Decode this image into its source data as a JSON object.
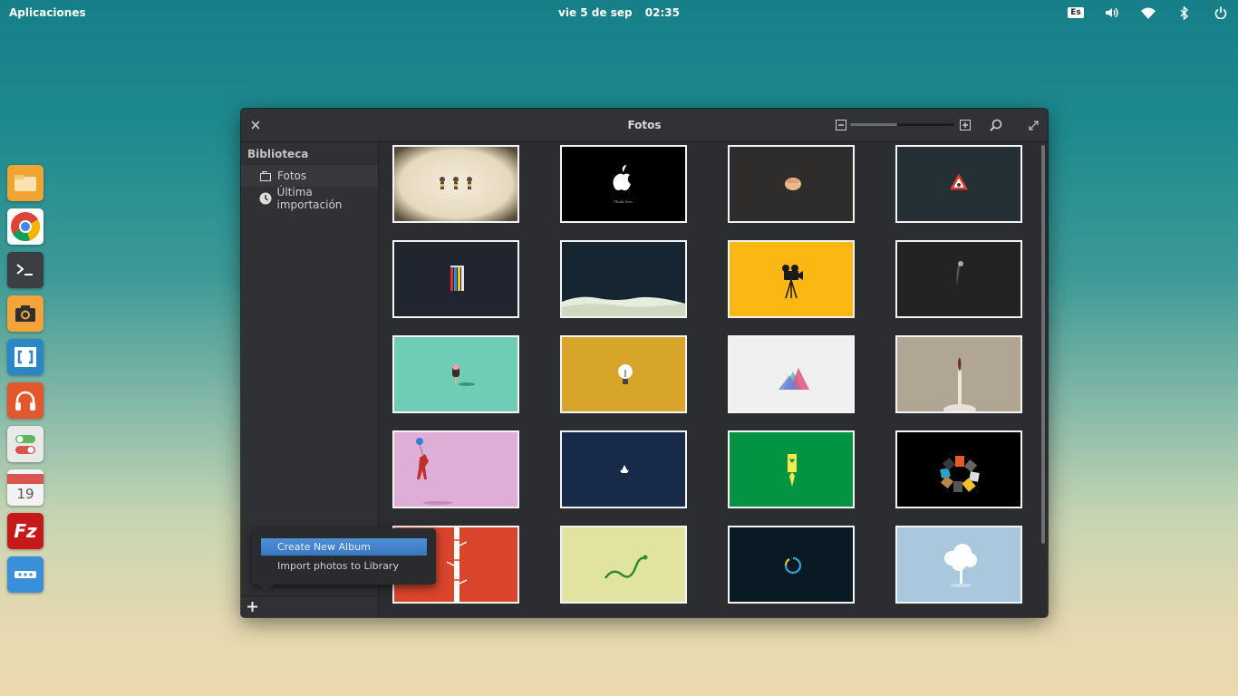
{
  "topbar": {
    "apps_label": "Aplicaciones",
    "date": "vie  5 de sep",
    "time": "02:35",
    "keyboard_layout": "Es",
    "icons": [
      "volume-icon",
      "wifi-icon",
      "bluetooth-icon",
      "power-icon"
    ]
  },
  "dock": {
    "apps": [
      {
        "name": "files",
        "color": "#f0a433"
      },
      {
        "name": "chrome",
        "color": "#ffffff"
      },
      {
        "name": "terminal",
        "color": "#3b3e42"
      },
      {
        "name": "camera",
        "color": "#f2a43a"
      },
      {
        "name": "brackets",
        "color": "#2b86c5"
      },
      {
        "name": "music",
        "color": "#e2572b"
      },
      {
        "name": "settings-toggles",
        "color": "#e9e9e9"
      },
      {
        "name": "calendar",
        "color": "#f3f3f3",
        "day": "19"
      },
      {
        "name": "filezilla",
        "color": "#c51a1a",
        "letter": "Fz"
      },
      {
        "name": "more-apps",
        "color": "#3a8fd9"
      }
    ]
  },
  "window": {
    "title": "Fotos",
    "zoom_level": 0.45
  },
  "sidebar": {
    "heading": "Biblioteca",
    "items": [
      {
        "label": "Fotos",
        "icon": "photos-icon",
        "active": true
      },
      {
        "label": "Última importación",
        "icon": "clock-icon",
        "active": false
      }
    ]
  },
  "popover": {
    "items": [
      "Create New Album",
      "Import photos to Library"
    ]
  },
  "photos": [
    {
      "bg": "#e9dcc4",
      "motif": "figures"
    },
    {
      "bg": "#000000",
      "motif": "apple"
    },
    {
      "bg": "#2f2d2c",
      "motif": "fist"
    },
    {
      "bg": "#243034",
      "motif": "sign"
    },
    {
      "bg": "#212530",
      "motif": "pencils"
    },
    {
      "bg": "#152532",
      "motif": "snow"
    },
    {
      "bg": "#fbb813",
      "motif": "camera"
    },
    {
      "bg": "#232323",
      "motif": "comet"
    },
    {
      "bg": "#6ecdb4",
      "motif": "icecream"
    },
    {
      "bg": "#d6a52a",
      "motif": "bulb"
    },
    {
      "bg": "#f0f0f0",
      "motif": "triangles"
    },
    {
      "bg": "#b1a594",
      "motif": "match"
    },
    {
      "bg": "#deaed7",
      "motif": "balloon"
    },
    {
      "bg": "#172a4a",
      "motif": "boat"
    },
    {
      "bg": "#029443",
      "motif": "tag"
    },
    {
      "bg": "#000000",
      "motif": "speakers"
    },
    {
      "bg": "#d9452a",
      "motif": "bamboo"
    },
    {
      "bg": "#e1e3a0",
      "motif": "snake"
    },
    {
      "bg": "#0a1a24",
      "motif": "spinner"
    },
    {
      "bg": "#a9c8de",
      "motif": "tree"
    }
  ]
}
